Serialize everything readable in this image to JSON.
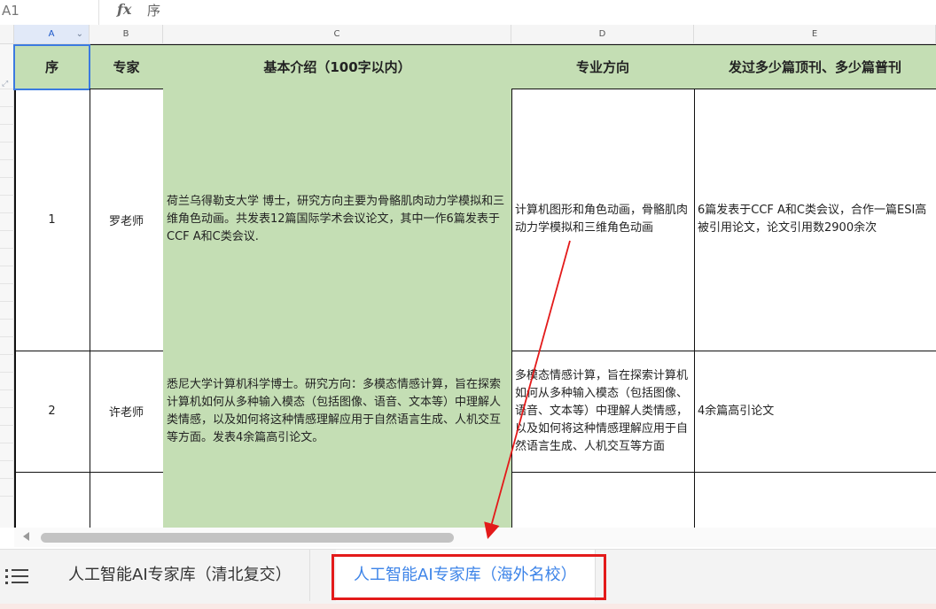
{
  "formula_bar": {
    "cell_ref": "A1",
    "fx": "fx",
    "content": "序"
  },
  "columns": [
    "A",
    "B",
    "C",
    "D",
    "E"
  ],
  "header_row": [
    "序",
    "专家",
    "基本介绍（100字以内）",
    "专业方向",
    "发过多少篇顶刊、多少篇普刊"
  ],
  "rows": [
    {
      "no": "1",
      "expert": "罗老师",
      "intro": "荷兰乌得勒支大学 博士，研究方向主要为骨骼肌肉动力学模拟和三维角色动画。共发表12篇国际学术会议论文，其中一作6篇发表于CCF A和C类会议.",
      "direction": "计算机图形和角色动画，骨骼肌肉动力学模拟和三维角色动画",
      "papers": "6篇发表于CCF A和C类会议，合作一篇ESI高被引用论文，论文引用数2900余次"
    },
    {
      "no": "2",
      "expert": "许老师",
      "intro": "悉尼大学计算机科学博士。研究方向：多模态情感计算，旨在探索计算机如何从多种输入模态（包括图像、语音、文本等）中理解人类情感，以及如何将这种情感理解应用于自然语言生成、人机交互等方面。发表4余篇高引论文。",
      "direction": "多模态情感计算，旨在探索计算机如何从多种输入模态（包括图像、语音、文本等）中理解人类情感，以及如何将这种情感理解应用于自然语言生成、人机交互等方面",
      "papers": "4余篇高引论文"
    }
  ],
  "sheet_tabs": [
    {
      "label": "人工智能AI专家库（清北复交）",
      "active": false
    },
    {
      "label": "人工智能AI专家库（海外名校）",
      "active": true
    }
  ],
  "icons": {
    "menu": "list-menu-icon",
    "formula": "fx-icon",
    "scroll_left": "arrow-left-icon"
  },
  "colors": {
    "header_green": "#c4deb4",
    "accent_blue": "#3d84e8",
    "annotation_red": "#e31a1a"
  }
}
